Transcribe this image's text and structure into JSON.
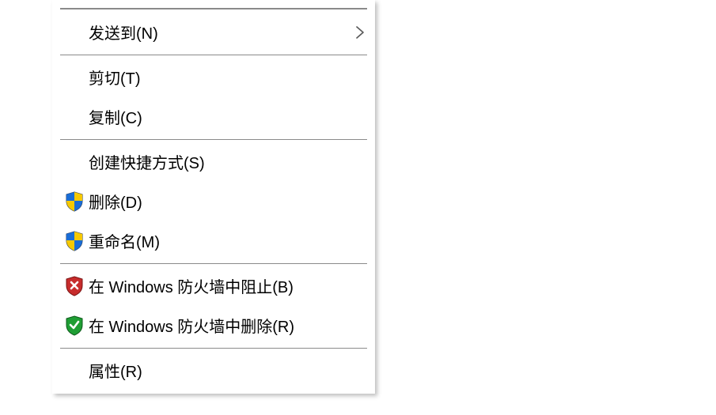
{
  "menu": {
    "sendTo": "发送到(N)",
    "cut": "剪切(T)",
    "copy": "复制(C)",
    "createShortcut": "创建快捷方式(S)",
    "delete": "删除(D)",
    "rename": "重命名(M)",
    "firewallBlock": "在 Windows 防火墙中阻止(B)",
    "firewallRemove": "在 Windows 防火墙中删除(R)",
    "properties": "属性(R)"
  }
}
